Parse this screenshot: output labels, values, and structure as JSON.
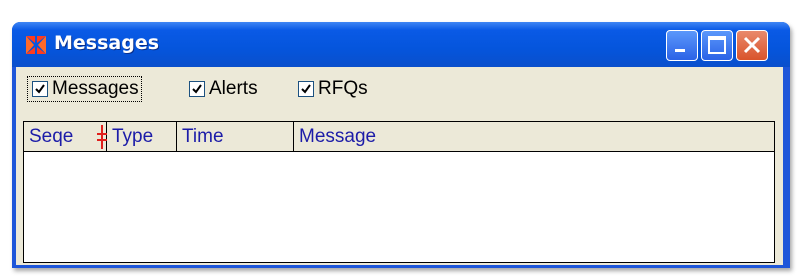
{
  "window": {
    "title": "Messages",
    "app_icon": "maltese-cross-icon",
    "caption_buttons": [
      "minimize-icon",
      "maximize-icon",
      "close-icon"
    ],
    "colors": {
      "title_bar": "#0555dc",
      "close_button": "#d9532b",
      "client": "#ece9d8",
      "header_text": "#1c1ca8"
    }
  },
  "filters": [
    {
      "label": "Messages",
      "checked": true
    },
    {
      "label": "Alerts",
      "checked": true
    },
    {
      "label": "RFQs",
      "checked": true
    }
  ],
  "table": {
    "columns": [
      "Seqe",
      "Type",
      "Time",
      "Message"
    ],
    "rows": []
  }
}
